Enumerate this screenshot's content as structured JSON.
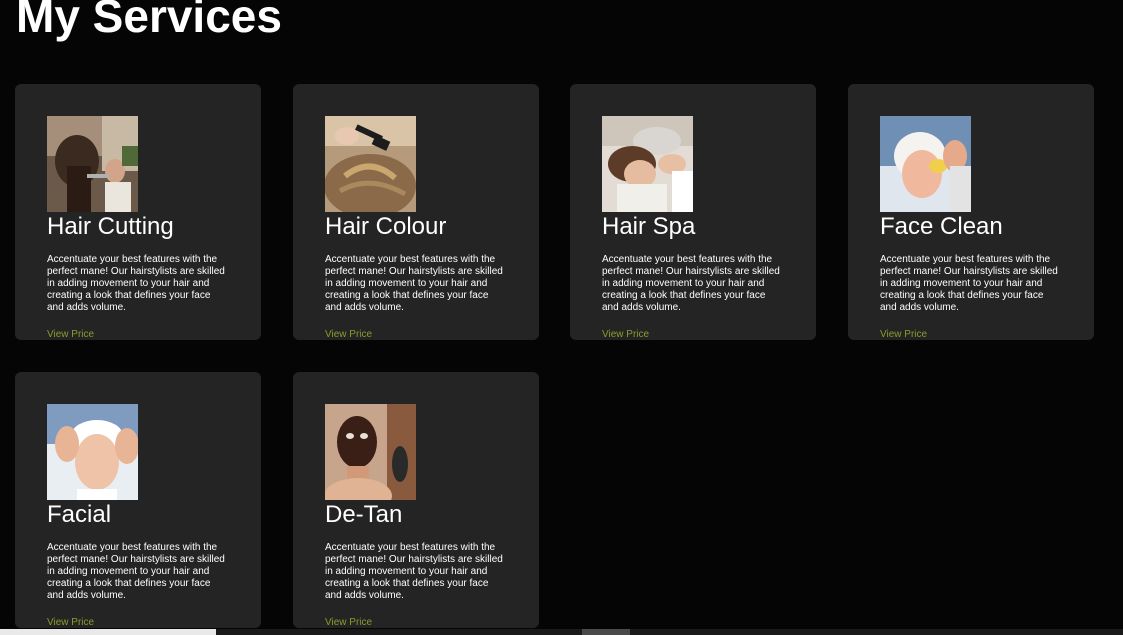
{
  "page": {
    "title": "My Services"
  },
  "services": [
    {
      "title": "Hair Cutting",
      "description": "Accentuate your best features with the perfect mane! Our hairstylists are skilled in adding movement to your hair and creating a look that defines your face and adds volume.",
      "link": "View Price"
    },
    {
      "title": "Hair Colour",
      "description": "Accentuate your best features with the perfect mane! Our hairstylists are skilled in adding movement to your hair and creating a look that defines your face and adds volume.",
      "link": "View Price"
    },
    {
      "title": "Hair Spa",
      "description": "Accentuate your best features with the perfect mane! Our hairstylists are skilled in adding movement to your hair and creating a look that defines your face and adds volume.",
      "link": "View Price"
    },
    {
      "title": "Face Clean",
      "description": "Accentuate your best features with the perfect mane! Our hairstylists are skilled in adding movement to your hair and creating a look that defines your face and adds volume.",
      "link": "View Price"
    },
    {
      "title": "Facial",
      "description": "Accentuate your best features with the perfect mane! Our hairstylists are skilled in adding movement to your hair and creating a look that defines your face and adds volume.",
      "link": "View Price"
    },
    {
      "title": "De-Tan",
      "description": "Accentuate your best features with the perfect mane! Our hairstylists are skilled in adding movement to your hair and creating a look that defines your face and adds volume.",
      "link": "View Price"
    }
  ],
  "colors": {
    "background": "#050505",
    "card": "#242424",
    "link": "#8f9a2e"
  }
}
